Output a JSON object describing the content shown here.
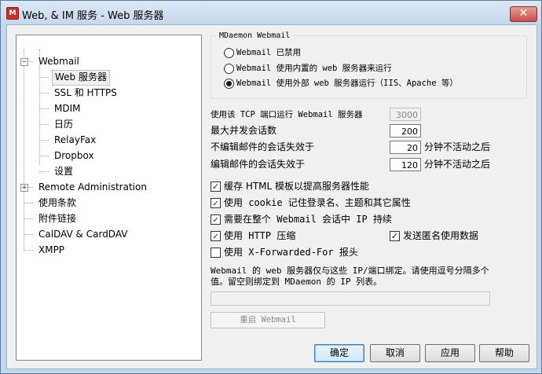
{
  "window": {
    "title": "Web, & IM 服务 - Web 服务器",
    "close_glyph": "✕"
  },
  "tree": {
    "items": [
      {
        "label": "Webmail",
        "expander": "−"
      },
      {
        "label": "Web 服务器"
      },
      {
        "label": "SSL 和 HTTPS"
      },
      {
        "label": "MDIM"
      },
      {
        "label": "日历"
      },
      {
        "label": "RelayFax"
      },
      {
        "label": "Dropbox"
      },
      {
        "label": "设置"
      },
      {
        "label": "Remote Administration",
        "expander": "+"
      },
      {
        "label": "使用条款"
      },
      {
        "label": "附件链接"
      },
      {
        "label": "CalDAV & CardDAV"
      },
      {
        "label": "XMPP"
      }
    ]
  },
  "webmail_group": {
    "title": "MDaemon Webmail",
    "options": [
      {
        "label": "Webmail 已禁用",
        "selected": false
      },
      {
        "label": "Webmail 使用内置的 web 服务器来运行",
        "selected": false
      },
      {
        "label": "Webmail 使用外部 web 服务器运行（IIS、Apache 等）",
        "selected": true
      }
    ]
  },
  "settings": {
    "tcp_port_label": "使用该 TCP 端口运行 Webmail 服务器",
    "tcp_port_value": "3000",
    "max_sessions_label": "最大并发会话数",
    "max_sessions_value": "200",
    "no_compose_timeout_label": "不编辑邮件的会话失效于",
    "no_compose_timeout_value": "20",
    "compose_timeout_label": "编辑邮件的会话失效于",
    "compose_timeout_value": "120",
    "minutes_inactive_label": "分钟不活动之后"
  },
  "checkboxes": [
    {
      "label": "缓存 HTML 模板以提高服务器性能",
      "checked": true
    },
    {
      "label": "使用 cookie 记住登录名、主题和其它属性",
      "checked": true
    },
    {
      "label": "需要在整个 Webmail 会话中 IP 持续",
      "checked": true
    },
    {
      "label": "使用 HTTP 压缩",
      "checked": true
    },
    {
      "label": "发送匿名使用数据",
      "checked": true
    },
    {
      "label": "使用 X-Forwarded-For 报头",
      "checked": false
    }
  ],
  "check_glyph": "✓",
  "bind_note": "Webmail 的 web 服务器仅与这些 IP/端口绑定。请使用逗号分隔多个值。留空则绑定到 MDaemon 的 IP 列表。",
  "bind_ip_value": "",
  "restart_button": "重启 Webmail",
  "buttons": {
    "ok": "确定",
    "cancel": "取消",
    "apply": "应用",
    "help": "帮助"
  },
  "colors": {
    "title_bar": "#c6d8ec",
    "close": "#c75050",
    "accent": "#3c7fb1"
  }
}
